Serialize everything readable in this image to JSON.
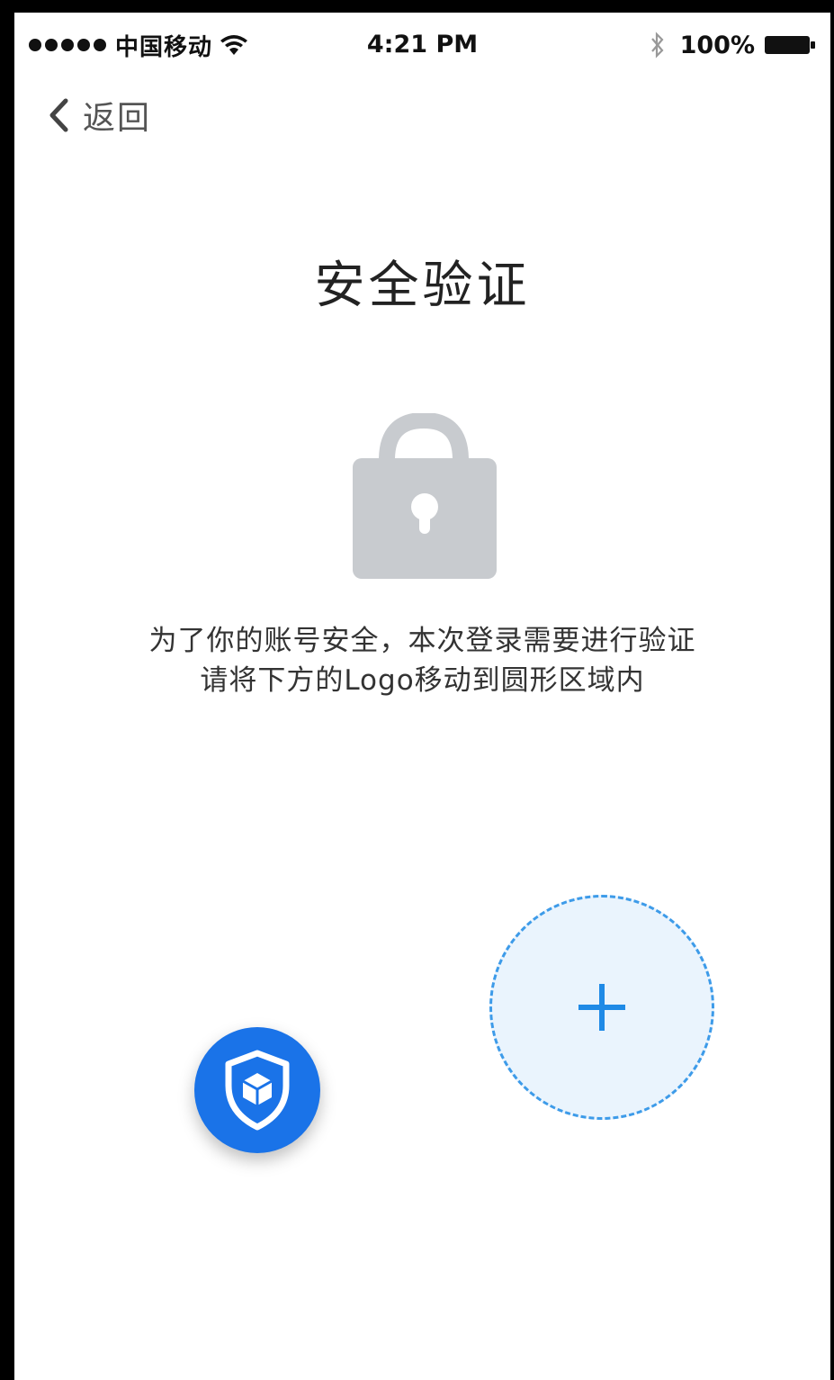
{
  "status_bar": {
    "carrier": "中国移动",
    "time": "4:21 PM",
    "battery": "100%",
    "signal_icon": "signal-dots-icon",
    "wifi_icon": "wifi-icon",
    "bluetooth_icon": "bluetooth-icon",
    "battery_icon": "battery-icon"
  },
  "nav": {
    "back_label": "返回",
    "back_icon": "chevron-left-icon"
  },
  "page": {
    "title": "安全验证",
    "lock_icon": "lock-icon",
    "instruction_line1": "为了你的账号安全，本次登录需要进行验证",
    "instruction_line2": "请将下方的Logo移动到圆形区域内"
  },
  "verification": {
    "logo_icon": "shield-cube-icon",
    "target_icon": "plus-icon"
  },
  "colors": {
    "accent": "#1a73e8",
    "target_fill": "#eaf4fd",
    "target_border": "#3d9be9",
    "lock_gray": "#c8cbcf"
  }
}
